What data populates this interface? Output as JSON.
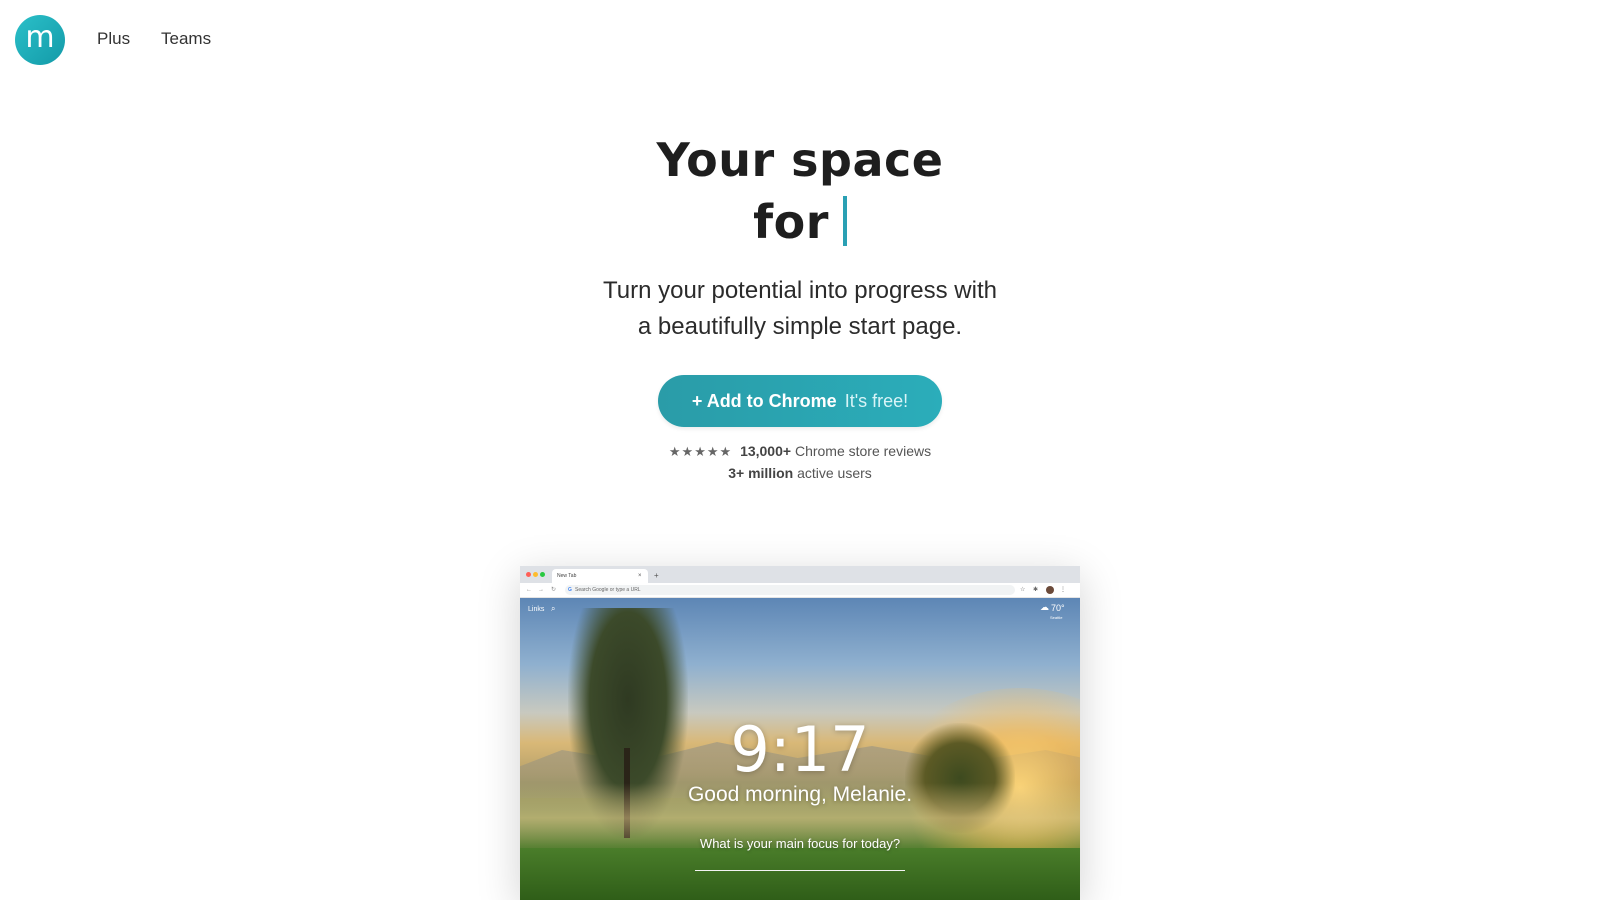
{
  "header": {
    "logo_letter": "m",
    "nav": [
      {
        "label": "Plus"
      },
      {
        "label": "Teams"
      }
    ]
  },
  "hero": {
    "title_line1": "Your space",
    "title_line2": "for",
    "subtitle_line1": "Turn your potential into progress with",
    "subtitle_line2": "a beautifully simple start page.",
    "cta_main": "+ Add to Chrome",
    "cta_sub": "It's free!",
    "stars": "★★★★★",
    "reviews_count": "13,000+",
    "reviews_text": "Chrome store reviews",
    "users_count": "3+ million",
    "users_text": "active users"
  },
  "browser": {
    "tab_title": "New Tab",
    "tab_close": "×",
    "tab_plus": "+",
    "url_placeholder": "Search Google or type a URL",
    "links_label": "Links",
    "weather_temp": "70°",
    "weather_location": "Seattle",
    "clock": "9:17",
    "greeting": "Good morning, Melanie.",
    "focus_question": "What is your main focus for today?"
  },
  "colors": {
    "brand_teal": "#2aa0b4",
    "cta_bg": "#2a9ca8"
  },
  "icons": [
    "search-icon",
    "star-icon",
    "weather-cloud-icon",
    "back-arrow-icon",
    "forward-arrow-icon",
    "reload-icon"
  ]
}
